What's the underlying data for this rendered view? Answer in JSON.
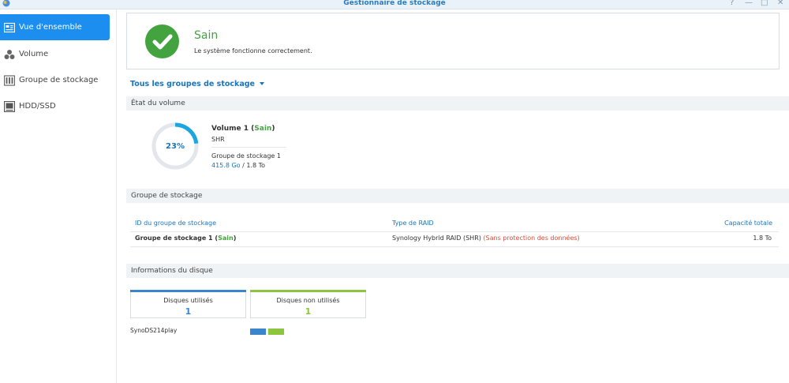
{
  "window": {
    "title": "Gestionnaire de stockage"
  },
  "colors": {
    "accent": "#1b8ef0",
    "link": "#1a75bb",
    "healthy": "#43a33f",
    "warning_red": "#e04b3c",
    "donut_track": "#e3e6ea",
    "donut_fill": "#1ca6e0",
    "used_disk": "#3a86cc",
    "unused_disk": "#8cc63f"
  },
  "sidebar": {
    "items": [
      {
        "label": "Vue d'ensemble",
        "icon": "overview-icon",
        "active": true
      },
      {
        "label": "Volume",
        "icon": "volume-icon",
        "active": false
      },
      {
        "label": "Groupe de stockage",
        "icon": "storage-pool-icon",
        "active": false
      },
      {
        "label": "HDD/SSD",
        "icon": "disk-icon",
        "active": false
      }
    ]
  },
  "status": {
    "title": "Sain",
    "description": "Le système fonctionne correctement.",
    "icon": "check-icon"
  },
  "group_selector": {
    "label": "Tous les groupes de stockage"
  },
  "volume_section": {
    "heading": "État du volume",
    "usage_percent": 23,
    "usage_label": "23%",
    "name": "Volume 1",
    "status_open": " (",
    "status": "Sain",
    "status_close": ")",
    "type": "SHR",
    "pool": "Groupe de stockage 1",
    "used": "415.8 Go",
    "separator": " / ",
    "total": "1.8 To"
  },
  "pool_section": {
    "heading": "Groupe de stockage",
    "columns": {
      "id": "ID du groupe de stockage",
      "raid": "Type de RAID",
      "capacity": "Capacité totale"
    },
    "rows": [
      {
        "name": "Groupe de stockage 1",
        "status_open": " (",
        "status": "Sain",
        "status_close": ")",
        "raid": "Synology Hybrid RAID (SHR) ",
        "raid_note": "(Sans protection des données)",
        "capacity": "1.8 To"
      }
    ]
  },
  "disk_section": {
    "heading": "Informations du disque",
    "used": {
      "label": "Disques utilisés",
      "value": "1"
    },
    "unused": {
      "label": "Disques non utilisés",
      "value": "1"
    },
    "device": "SynoDS214play"
  }
}
